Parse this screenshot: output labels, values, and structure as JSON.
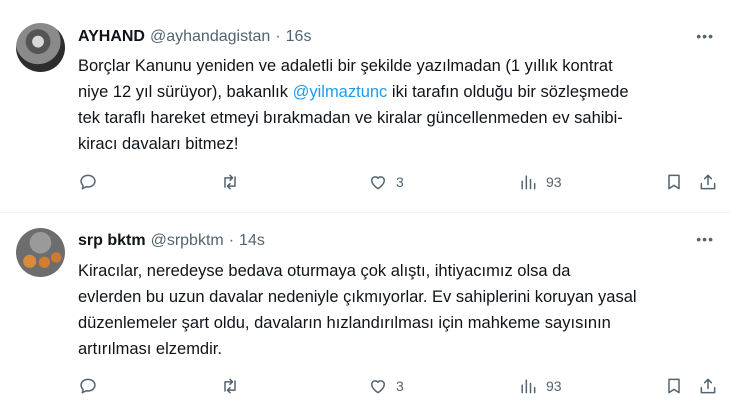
{
  "tweets": [
    {
      "name": "AYHAND",
      "handle": "@ayhandagistan",
      "separator": "·",
      "time": "16s",
      "line1": "Borçlar Kanunu yeniden ve adaletli bir şekilde yazılmadan (1 yıllık kontrat",
      "line2": "niye 12 yıl sürüyor), bakanlık ",
      "mention": "@yilmaztunc",
      "line2_after": " iki tarafın olduğu bir sözleşmede",
      "line3": "tek taraflı hareket etmeyi bırakmadan ve kiralar güncellenmeden ev sahibi-",
      "line4": "kiracı davaları bitmez!",
      "likes": "3",
      "views": "93"
    },
    {
      "name": "srp bktm",
      "handle": "@srpbktm",
      "separator": "·",
      "time": "14s",
      "line1": "Kiracılar, neredeyse bedava oturmaya çok alıştı, ihtiyacımız olsa da",
      "line2": "evlerden bu uzun davalar nedeniyle çıkmıyorlar. Ev sahiplerini koruyan yasal",
      "line3": "düzenlemeler şart oldu, davaların hızlandırılması için mahkeme sayısının",
      "line4": "artırılması elzemdir.",
      "likes": "3",
      "views": "93"
    }
  ],
  "icons": {
    "reply": "comment-bubble-icon",
    "retweet": "retweet-icon",
    "like": "heart-icon",
    "views": "bar-chart-icon",
    "bookmark": "bookmark-icon",
    "share": "share-icon",
    "more": "more-dots-icon"
  },
  "colors": {
    "link": "#1d9bf0",
    "secondary": "#536471",
    "text": "#0f1419"
  }
}
